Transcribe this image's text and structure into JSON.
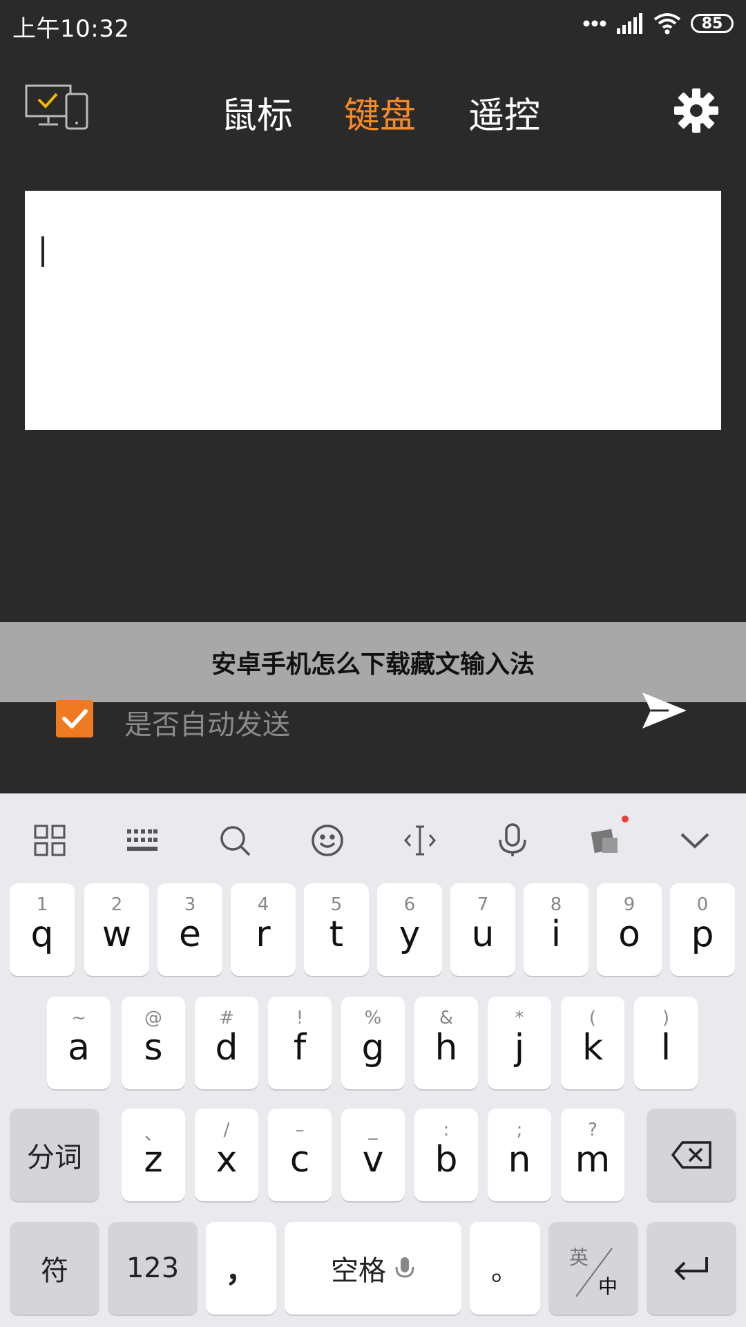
{
  "status": {
    "time": "上午10:32",
    "battery": "85"
  },
  "nav": {
    "tabs": [
      {
        "label": "鼠标",
        "active": false
      },
      {
        "label": "键盘",
        "active": true
      },
      {
        "label": "遥控",
        "active": false
      }
    ],
    "accent_color": "#f58a27"
  },
  "input": {
    "value": ""
  },
  "banner": {
    "text": "安卓手机怎么下载藏文输入法"
  },
  "autosend": {
    "label": "是否自动发送",
    "checked": true
  },
  "keyboard": {
    "row1": [
      {
        "sub": "1",
        "main": "q"
      },
      {
        "sub": "2",
        "main": "w"
      },
      {
        "sub": "3",
        "main": "e"
      },
      {
        "sub": "4",
        "main": "r"
      },
      {
        "sub": "5",
        "main": "t"
      },
      {
        "sub": "6",
        "main": "y"
      },
      {
        "sub": "7",
        "main": "u"
      },
      {
        "sub": "8",
        "main": "i"
      },
      {
        "sub": "9",
        "main": "o"
      },
      {
        "sub": "0",
        "main": "p"
      }
    ],
    "row2": [
      {
        "sub": "~",
        "main": "a"
      },
      {
        "sub": "@",
        "main": "s"
      },
      {
        "sub": "#",
        "main": "d"
      },
      {
        "sub": "!",
        "main": "f"
      },
      {
        "sub": "%",
        "main": "g"
      },
      {
        "sub": "&",
        "main": "h"
      },
      {
        "sub": "*",
        "main": "j"
      },
      {
        "sub": "(",
        "main": "k"
      },
      {
        "sub": ")",
        "main": "l"
      }
    ],
    "row3": [
      {
        "sub": "、",
        "main": "z"
      },
      {
        "sub": "/",
        "main": "x"
      },
      {
        "sub": "–",
        "main": "c"
      },
      {
        "sub": "_",
        "main": "v"
      },
      {
        "sub": ":",
        "main": "b"
      },
      {
        "sub": ";",
        "main": "n"
      },
      {
        "sub": "?",
        "main": "m"
      }
    ],
    "split_label": "分词",
    "symbol_label": "符",
    "num_label": "123",
    "comma": "，",
    "space_label": "空格",
    "period": "。",
    "lang_top": "英",
    "lang_bottom": "中"
  }
}
